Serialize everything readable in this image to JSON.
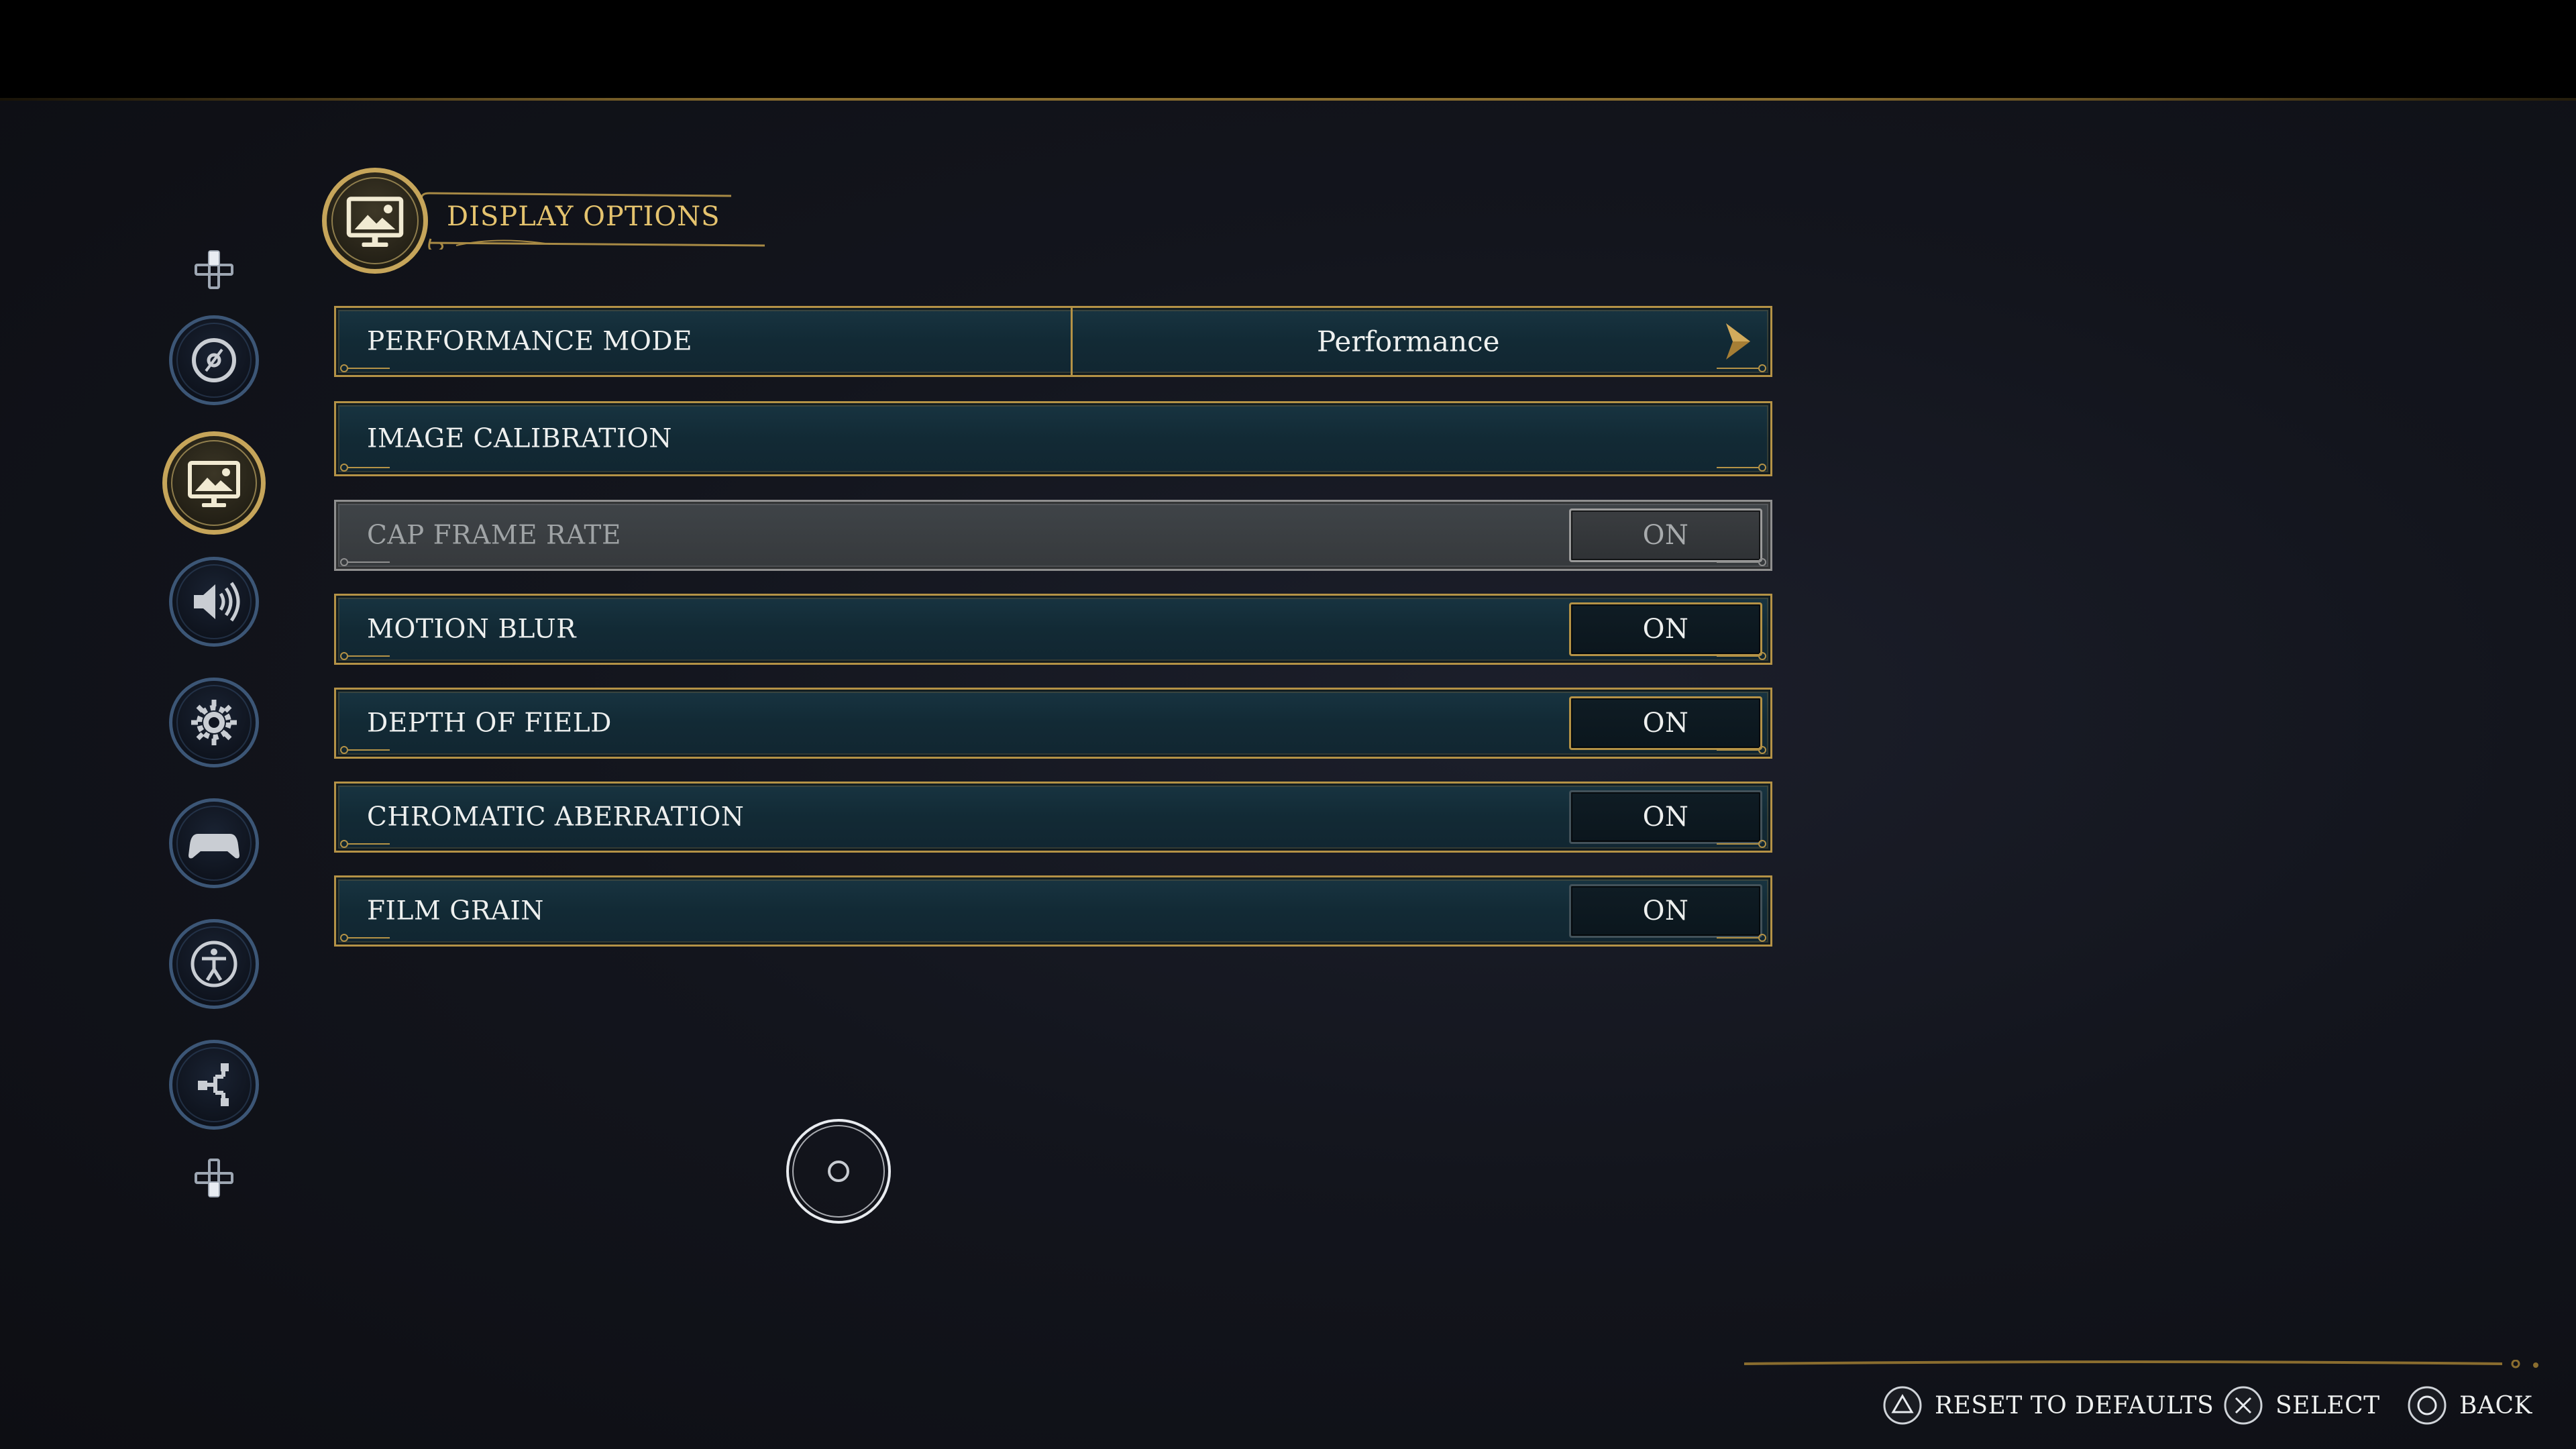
{
  "header": {
    "title": "DISPLAY OPTIONS",
    "icon": "display-icon"
  },
  "sidebar": {
    "categories": [
      {
        "icon": "disc-icon",
        "active": false
      },
      {
        "icon": "display-icon",
        "active": true
      },
      {
        "icon": "speaker-icon",
        "active": false
      },
      {
        "icon": "gear-icon",
        "active": false
      },
      {
        "icon": "gamepad-icon",
        "active": false
      },
      {
        "icon": "accessibility-icon",
        "active": false
      },
      {
        "icon": "network-icon",
        "active": false
      }
    ],
    "nav_hint_icon": "dpad-icon"
  },
  "settings": {
    "performance_mode": {
      "label": "PERFORMANCE MODE",
      "value": "Performance"
    },
    "image_calibration": {
      "label": "IMAGE CALIBRATION"
    },
    "cap_frame_rate": {
      "label": "CAP FRAME RATE",
      "value": "ON",
      "disabled": true
    },
    "motion_blur": {
      "label": "MOTION BLUR",
      "value": "ON"
    },
    "depth_of_field": {
      "label": "DEPTH OF FIELD",
      "value": "ON"
    },
    "chromatic_aberration": {
      "label": "CHROMATIC ABERRATION",
      "value": "ON"
    },
    "film_grain": {
      "label": "FILM GRAIN",
      "value": "ON"
    }
  },
  "footer": {
    "reset": {
      "icon": "triangle-button-icon",
      "label": "RESET TO DEFAULTS"
    },
    "select": {
      "icon": "cross-button-icon",
      "label": "SELECT"
    },
    "back": {
      "icon": "circle-button-icon",
      "label": "BACK"
    }
  },
  "colors": {
    "gold": "#c6a55a",
    "row_fill": "#163240",
    "disabled_fill": "#3a3e41",
    "text": "#eef0ef"
  }
}
